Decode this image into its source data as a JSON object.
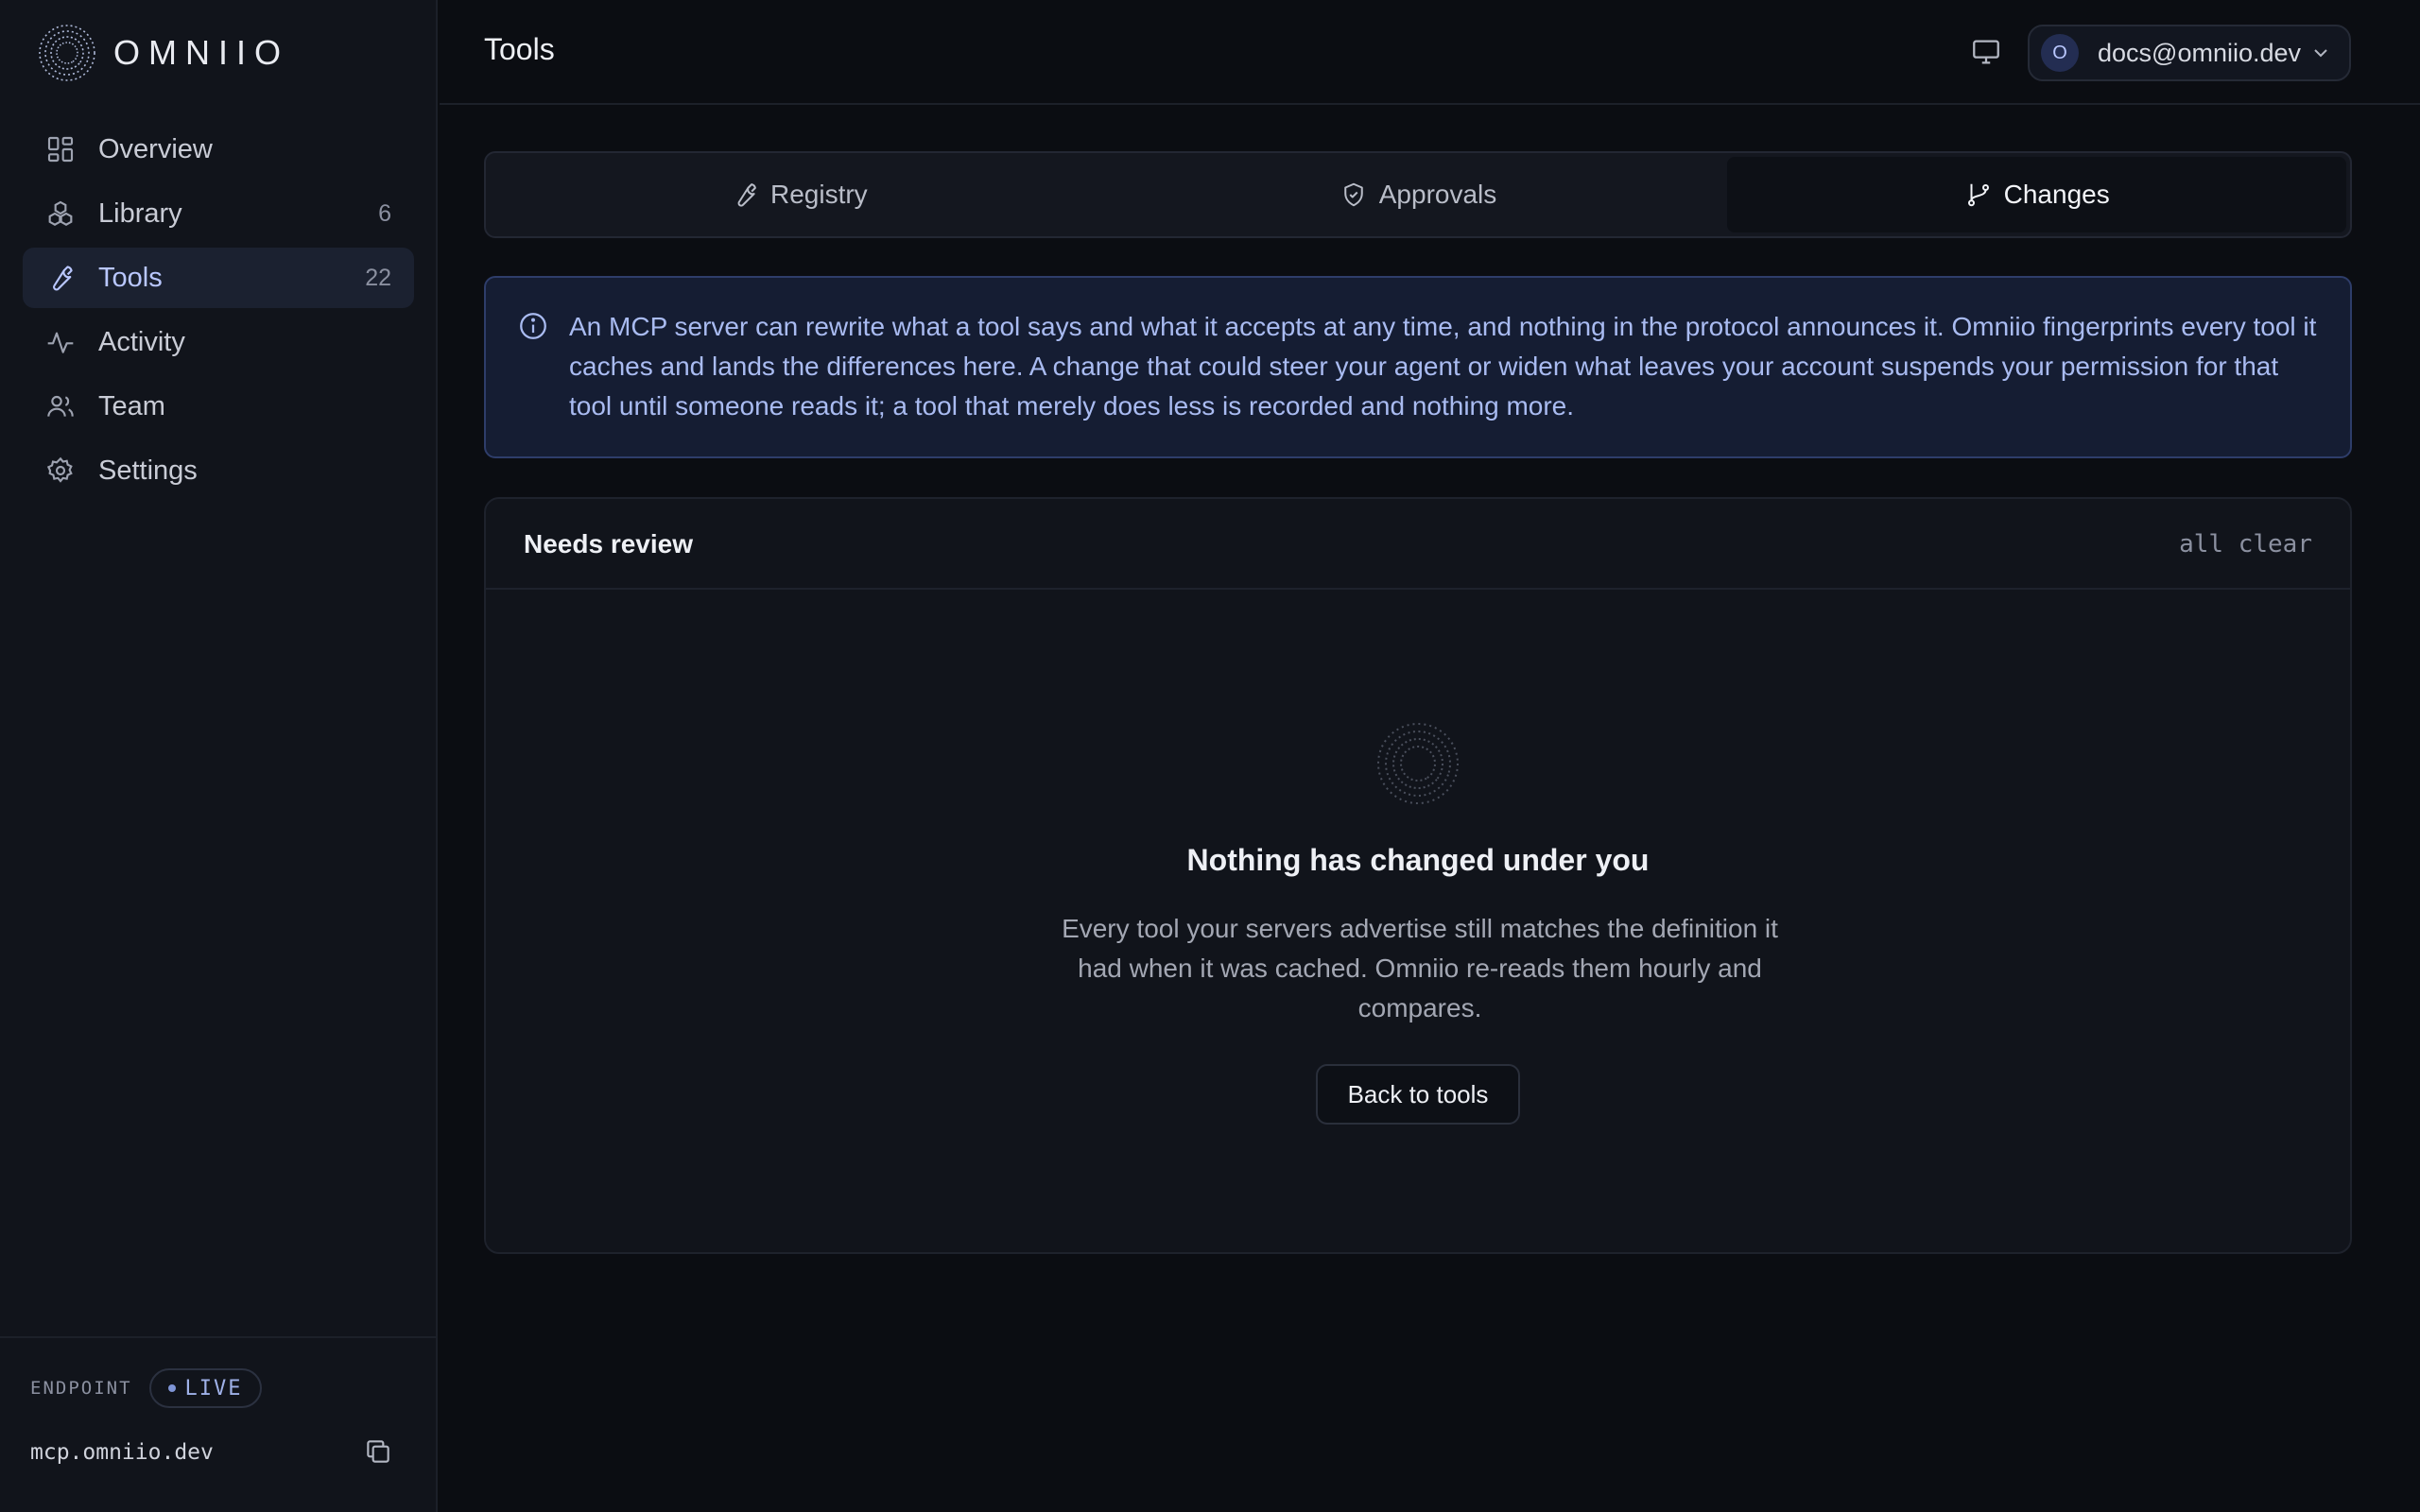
{
  "brand": {
    "name": "OMNIIO",
    "logo_icon": "spiral-logo-icon"
  },
  "sidebar": {
    "items": [
      {
        "label": "Overview",
        "icon": "grid-icon",
        "count": ""
      },
      {
        "label": "Library",
        "icon": "boxes-icon",
        "count": "6"
      },
      {
        "label": "Tools",
        "icon": "wrench-icon",
        "count": "22",
        "active": true
      },
      {
        "label": "Activity",
        "icon": "pulse-icon",
        "count": ""
      },
      {
        "label": "Team",
        "icon": "users-icon",
        "count": ""
      },
      {
        "label": "Settings",
        "icon": "gear-icon",
        "count": ""
      }
    ],
    "footer": {
      "endpoint_label": "ENDPOINT",
      "live_label": "LIVE",
      "host": "mcp.omniio.dev"
    }
  },
  "header": {
    "title": "Tools",
    "account": {
      "initial": "O",
      "email": "docs@omniio.dev"
    }
  },
  "tabs": [
    {
      "label": "Registry",
      "icon": "wrench-icon",
      "active": false
    },
    {
      "label": "Approvals",
      "icon": "shield-check-icon",
      "active": false
    },
    {
      "label": "Changes",
      "icon": "git-branch-icon",
      "active": true
    }
  ],
  "notice": {
    "text": "An MCP server can rewrite what a tool says and what it accepts at any time, and nothing in the protocol announces it. Omniio fingerprints every tool it caches and lands the differences here. A change that could steer your agent or widen what leaves your account suspends your permission for that tool until someone reads it; a tool that merely does less is recorded and nothing more."
  },
  "review_panel": {
    "title": "Needs review",
    "status": "all clear",
    "empty_title": "Nothing has changed under you",
    "empty_description": "Every tool your servers advertise still matches the definition it had when it was cached. Omniio re-reads them hourly and compares.",
    "button_label": "Back to tools"
  },
  "colors": {
    "background": "#0b0d12",
    "sidebar": "#11141b",
    "accent": "#b9c7ff",
    "notice_bg": "#151d33",
    "notice_text": "#a9bbf1"
  }
}
